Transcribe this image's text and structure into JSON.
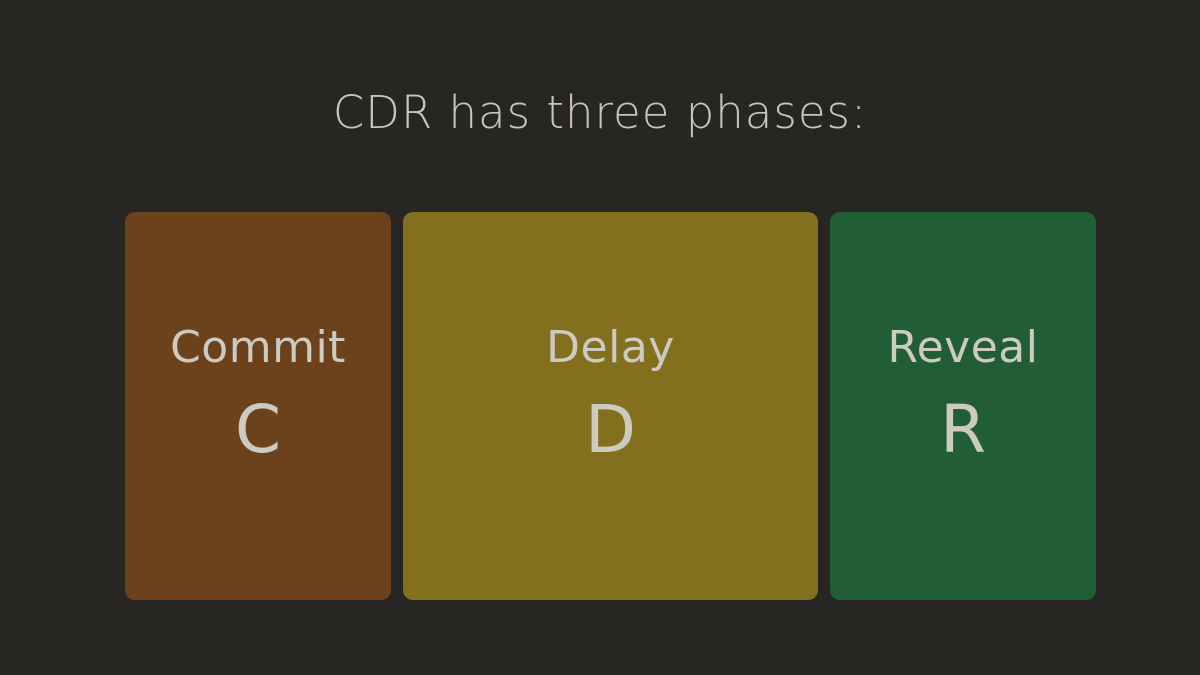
{
  "title": "CDR has three phases:",
  "phases": [
    {
      "name": "Commit",
      "letter": "C",
      "color": "#6b421c"
    },
    {
      "name": "Delay",
      "letter": "D",
      "color": "#82701e"
    },
    {
      "name": "Reveal",
      "letter": "R",
      "color": "#215d35"
    }
  ],
  "colors": {
    "background": "#282623",
    "text": "#cdcabf"
  }
}
